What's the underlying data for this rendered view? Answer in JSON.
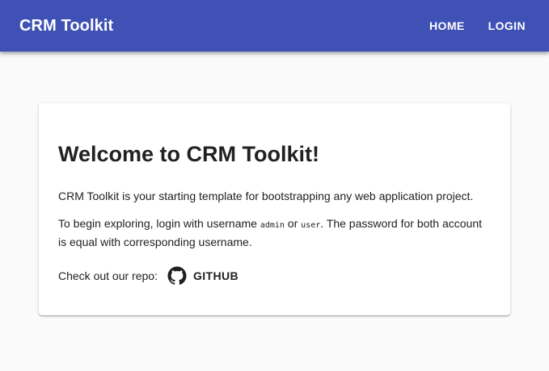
{
  "header": {
    "title": "CRM Toolkit",
    "nav": [
      {
        "label": "HOME"
      },
      {
        "label": "LOGIN"
      }
    ],
    "bar_color": "#3f51b5"
  },
  "card": {
    "heading": "Welcome to CRM Toolkit!",
    "intro": "CRM Toolkit is your starting template for bootstrapping any web application project.",
    "login_text_1": "To begin exploring, login with username ",
    "username_admin": "admin",
    "login_text_2": " or ",
    "username_user": "user",
    "login_text_3": ". The password for both account is equal with corresponding username.",
    "repo_prompt": "Check out our repo:",
    "repo_link": {
      "label": "GITHUB",
      "icon": "github-icon"
    }
  }
}
